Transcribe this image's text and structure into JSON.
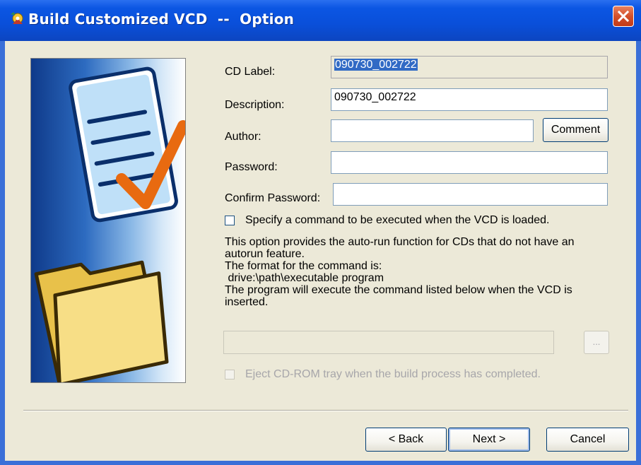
{
  "window": {
    "title": "Build Customized VCD  --  Option",
    "title_icon": "app-icon",
    "close_icon": "close-icon",
    "colors": {
      "titlebar": "#0a4fd9",
      "face": "#ece9d8",
      "close": "#d3502b",
      "selection": "#316ac5"
    }
  },
  "form": {
    "cd_label": {
      "label": "CD Label:",
      "value": "090730_002722"
    },
    "description": {
      "label": "Description:",
      "value": "090730_002722"
    },
    "author": {
      "label": "Author:",
      "value": ""
    },
    "comment_button": "Comment",
    "password": {
      "label": "Password:",
      "value": ""
    },
    "confirm_password": {
      "label": "Confirm Password:",
      "value": ""
    }
  },
  "autorun": {
    "checkbox_label": "Specify a command to be executed when the VCD is loaded.",
    "checked": false,
    "description_lines": [
      "This option provides the auto-run function for CDs that do not have an",
      "autorun feature.",
      "The format for the command is:",
      " drive:\\path\\executable program",
      "The program will execute the command listed below when the VCD is",
      "inserted."
    ],
    "command_value": "",
    "browse_label": "..."
  },
  "eject": {
    "checkbox_label": "Eject CD-ROM tray when the build process has completed.",
    "checked": false
  },
  "buttons": {
    "back": "< Back",
    "next": "Next >",
    "cancel": "Cancel"
  }
}
